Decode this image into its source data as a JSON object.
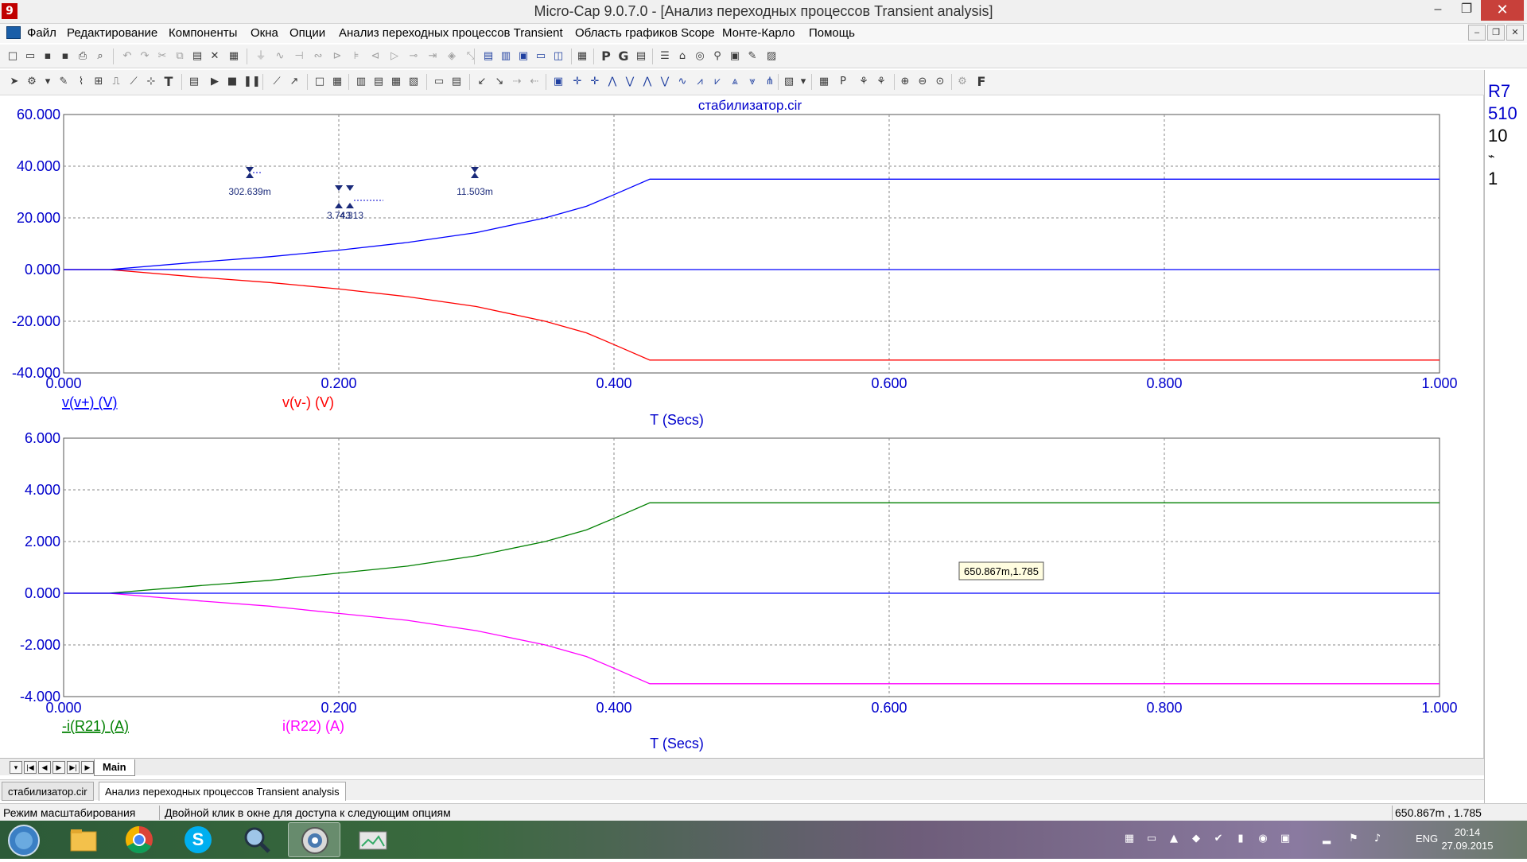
{
  "window": {
    "title": "Micro-Cap 9.0.7.0 - [Анализ переходных процессов Transient analysis]",
    "controls": {
      "minimize": "–",
      "maximize": "❐",
      "close": "✕"
    },
    "mdi_controls": {
      "minimize": "–",
      "restore": "❐",
      "close": "✕"
    }
  },
  "menu": [
    "Файл",
    "Редактирование",
    "Компоненты",
    "Окна",
    "Опции",
    "Анализ переходных процессов Transient",
    "Область графиков Scope",
    "Монте-Карло",
    "Помощь"
  ],
  "toolbar_right_letters": {
    "p": "P",
    "g": "G",
    "f": "F"
  },
  "plot": {
    "title": "стабилизатор.cir",
    "top": {
      "y_ticks": [
        "60.000",
        "40.000",
        "20.000",
        "0.000",
        "-20.000",
        "-40.000"
      ],
      "x_ticks": [
        "0.000",
        "0.200",
        "0.400",
        "0.600",
        "0.800",
        "1.000"
      ],
      "traces": [
        "v(v+) (V)",
        "v(v-) (V)"
      ],
      "x_axis_label": "T (Secs)",
      "annotations": [
        "302.639m",
        "3.743",
        "4.313",
        "11.503m"
      ]
    },
    "bottom": {
      "y_ticks": [
        "6.000",
        "4.000",
        "2.000",
        "0.000",
        "-2.000",
        "-4.000"
      ],
      "x_ticks": [
        "0.000",
        "0.200",
        "0.400",
        "0.600",
        "0.800",
        "1.000"
      ],
      "traces": [
        "-i(R21) (A)",
        "i(R22) (A)"
      ],
      "x_axis_label": "T (Secs)",
      "tooltip": "650.867m,1.785"
    },
    "colors": {
      "axis_text": "#0000cc",
      "trace1": "#0000ff",
      "trace2": "#ff0000",
      "trace3": "#008000",
      "trace4": "#ff00ff",
      "grid": "#888888"
    }
  },
  "chart_data": [
    {
      "type": "line",
      "title": "стабилизатор.cir",
      "xlabel": "T (Secs)",
      "xlim": [
        0,
        1
      ],
      "ylim": [
        -40,
        60
      ],
      "series": [
        {
          "name": "v(v+) (V)",
          "x": [
            0.0,
            0.033,
            0.1,
            0.15,
            0.2,
            0.25,
            0.3,
            0.35,
            0.38,
            0.4,
            0.426,
            0.5,
            0.6,
            0.7,
            0.8,
            0.9,
            1.0
          ],
          "y": [
            0,
            0,
            3.0,
            5.0,
            7.5,
            10.5,
            14.3,
            20.0,
            24.5,
            29.0,
            35.0,
            35.0,
            35.0,
            35.0,
            35.0,
            35.0,
            35.0
          ]
        },
        {
          "name": "v(v-) (V)",
          "x": [
            0.0,
            0.033,
            0.1,
            0.15,
            0.2,
            0.25,
            0.3,
            0.35,
            0.38,
            0.4,
            0.426,
            0.5,
            0.6,
            0.7,
            0.8,
            0.9,
            1.0
          ],
          "y": [
            0,
            0,
            -3.0,
            -5.0,
            -7.5,
            -10.5,
            -14.3,
            -20.0,
            -24.5,
            -29.0,
            -35.0,
            -35.0,
            -35.0,
            -35.0,
            -35.0,
            -35.0,
            -35.0
          ]
        },
        {
          "name": "",
          "x": [
            0.0,
            1.0
          ],
          "y": [
            0,
            0
          ]
        }
      ]
    },
    {
      "type": "line",
      "xlabel": "T (Secs)",
      "xlim": [
        0,
        1
      ],
      "ylim": [
        -4,
        6
      ],
      "series": [
        {
          "name": "-i(R21) (A)",
          "x": [
            0.0,
            0.033,
            0.1,
            0.15,
            0.2,
            0.25,
            0.3,
            0.35,
            0.38,
            0.4,
            0.426,
            0.5,
            0.6,
            0.7,
            0.8,
            0.9,
            1.0
          ],
          "y": [
            0,
            0,
            0.3,
            0.5,
            0.78,
            1.05,
            1.45,
            2.0,
            2.45,
            2.9,
            3.5,
            3.5,
            3.5,
            3.5,
            3.5,
            3.5,
            3.5
          ]
        },
        {
          "name": "i(R22) (A)",
          "x": [
            0.0,
            0.033,
            0.1,
            0.15,
            0.2,
            0.25,
            0.3,
            0.35,
            0.38,
            0.4,
            0.426,
            0.5,
            0.6,
            0.7,
            0.8,
            0.9,
            1.0
          ],
          "y": [
            0,
            0,
            -0.3,
            -0.5,
            -0.78,
            -1.05,
            -1.45,
            -2.0,
            -2.45,
            -2.9,
            -3.5,
            -3.5,
            -3.5,
            -3.5,
            -3.5,
            -3.5,
            -3.5
          ]
        },
        {
          "name": "",
          "x": [
            0.0,
            1.0
          ],
          "y": [
            0,
            0
          ]
        }
      ]
    }
  ],
  "side_panel": [
    "R7",
    "510",
    "10",
    "1"
  ],
  "sheet_tab": "Main",
  "document_tabs": [
    "стабилизатор.cir",
    "Анализ переходных процессов Transient analysis"
  ],
  "status": {
    "mode": "Режим масштабирования",
    "hint": "Двойной клик в окне для доступа к следующим опциям",
    "coords": "650.867m , 1.785"
  },
  "taskbar": {
    "apps": [
      "start-orb",
      "file-explorer",
      "chrome",
      "skype",
      "search-tool",
      "microcap",
      "image-viewer"
    ],
    "lang": "ENG",
    "time": "20:14",
    "date": "27.09.2015"
  }
}
